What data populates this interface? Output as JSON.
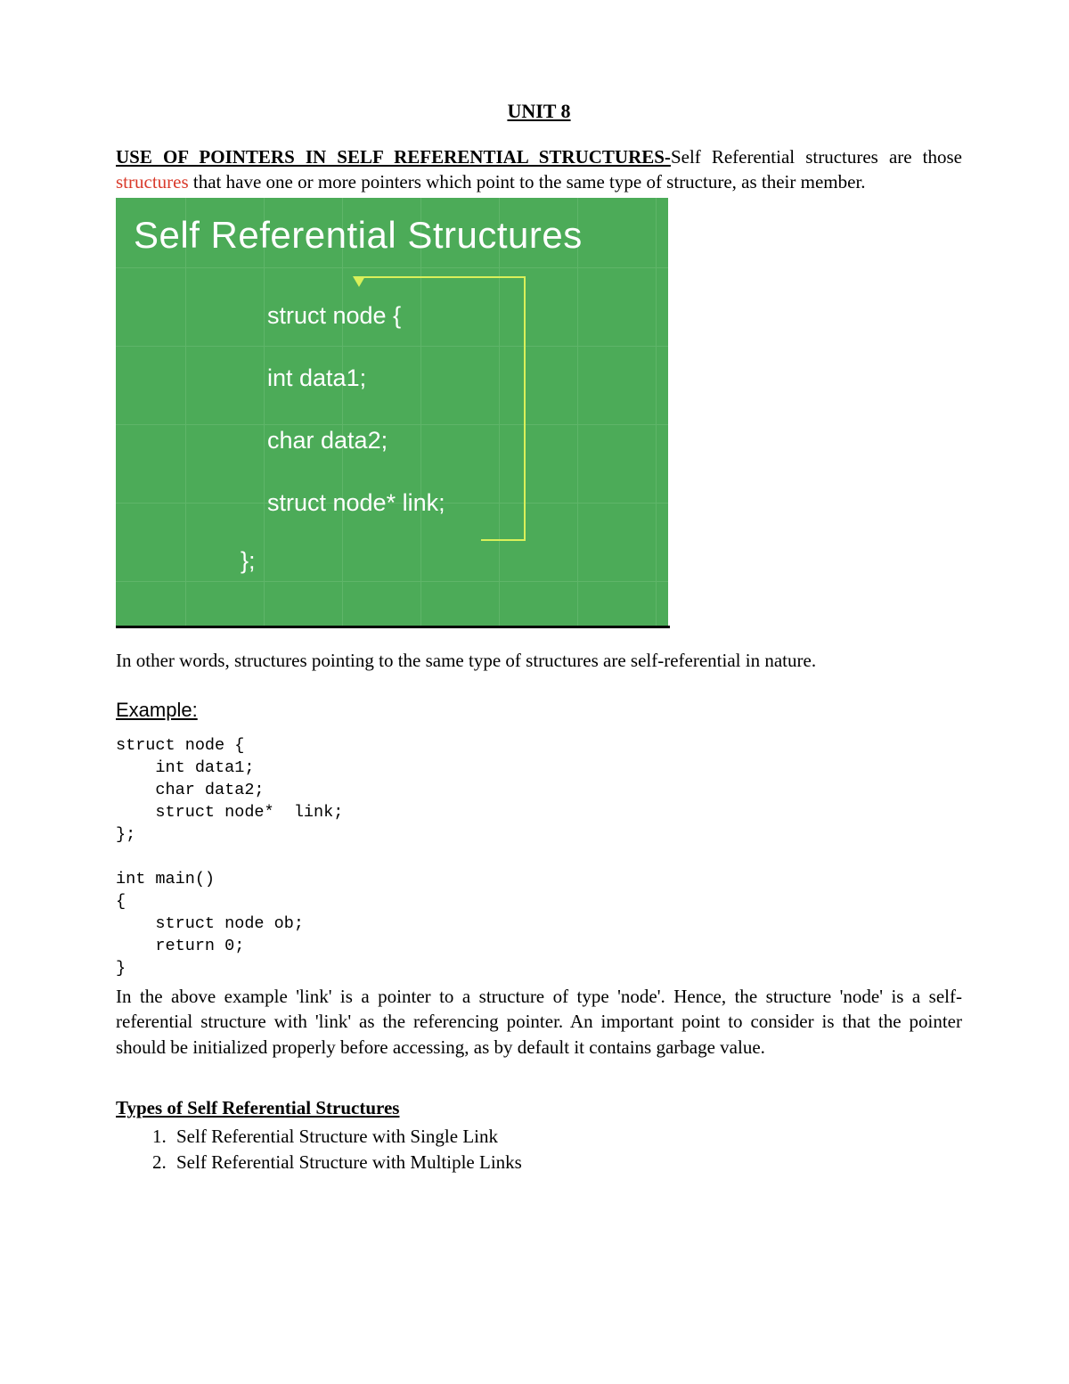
{
  "title": "UNIT 8",
  "intro": {
    "heading": "USE OF POINTERS IN SELF REFERENTIAL STRUCTURES-",
    "before_link": "Self Referential structures are those ",
    "link": "structures",
    "after_link": " that have one or more pointers which point to the same type of structure, as their member."
  },
  "diagram": {
    "title": "Self Referential Structures",
    "lines": [
      "struct node {",
      "int data1;",
      "char data2;",
      "struct node* link;"
    ],
    "close": "};"
  },
  "after_diagram": "In other words, structures pointing to the same type of structures are self-referential in nature.",
  "example_label": "Example:",
  "code": "struct node {\n    int data1;\n    char data2;\n    struct node*  link;\n};\n\nint main()\n{\n    struct node ob;\n    return 0;\n}",
  "explain": "In the above example 'link' is a pointer to a structure of type 'node'. Hence, the structure 'node' is a self-referential structure with 'link' as the referencing pointer. An important point to consider is that the pointer should be initialized properly before accessing, as by default it contains garbage value.",
  "types": {
    "heading": "Types of Self Referential Structures",
    "items": [
      "Self Referential Structure with Single Link",
      "Self Referential Structure with Multiple Links"
    ]
  }
}
